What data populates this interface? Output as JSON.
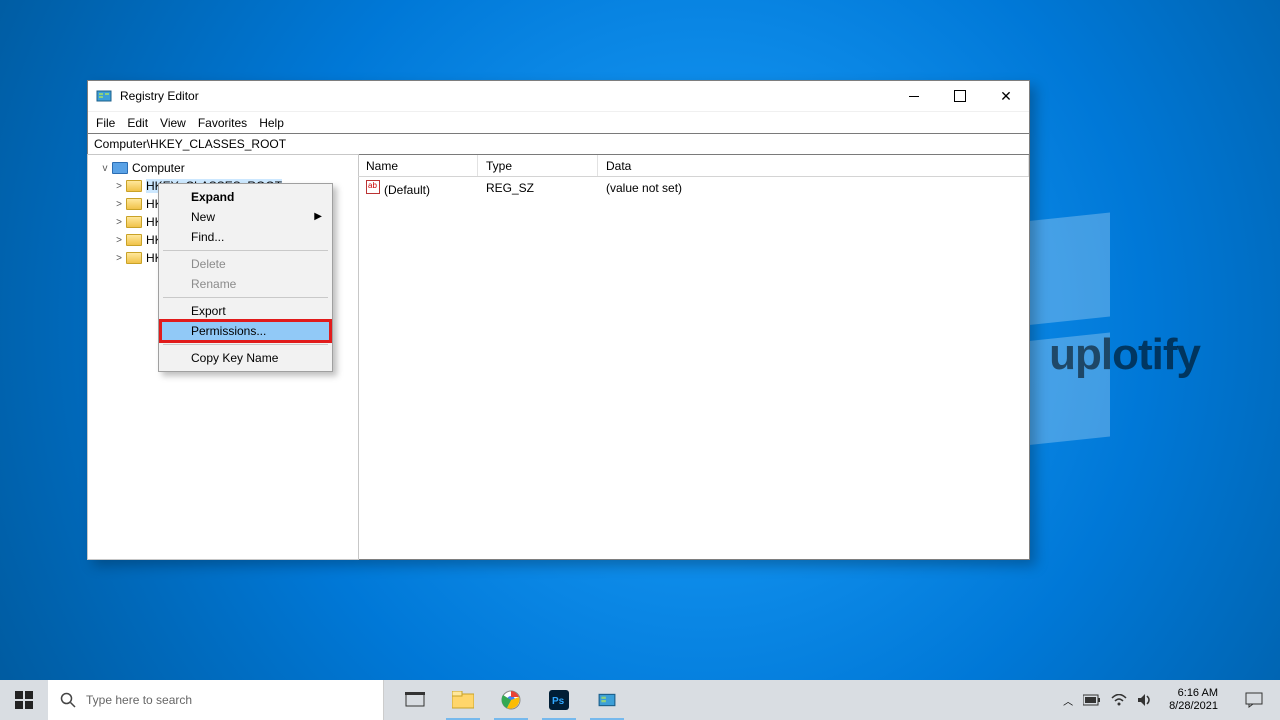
{
  "window": {
    "title": "Registry Editor",
    "menus": {
      "file": "File",
      "edit": "Edit",
      "view": "View",
      "favorites": "Favorites",
      "help": "Help"
    },
    "addressbar": "Computer\\HKEY_CLASSES_ROOT"
  },
  "tree": {
    "root": "Computer",
    "keys": [
      "HKEY_CLASSES_ROOT",
      "HKEY_CURRENT_USER",
      "HKEY_LOCAL_MACHINE",
      "HKEY_USERS",
      "HKEY_CURRENT_CONFIG"
    ],
    "keys_truncated": [
      "HK",
      "HK",
      "HK",
      "HK"
    ]
  },
  "list": {
    "headers": {
      "name": "Name",
      "type": "Type",
      "data": "Data"
    },
    "rows": [
      {
        "name": "(Default)",
        "type": "REG_SZ",
        "data": "(value not set)"
      }
    ]
  },
  "context_menu": {
    "expand": "Expand",
    "new": "New",
    "find": "Find...",
    "delete": "Delete",
    "rename": "Rename",
    "export": "Export",
    "permissions": "Permissions...",
    "copy_key_name": "Copy Key Name"
  },
  "taskbar": {
    "search_placeholder": "Type here to search",
    "time": "6:16 AM",
    "date": "8/28/2021"
  },
  "watermark": "uplotify"
}
